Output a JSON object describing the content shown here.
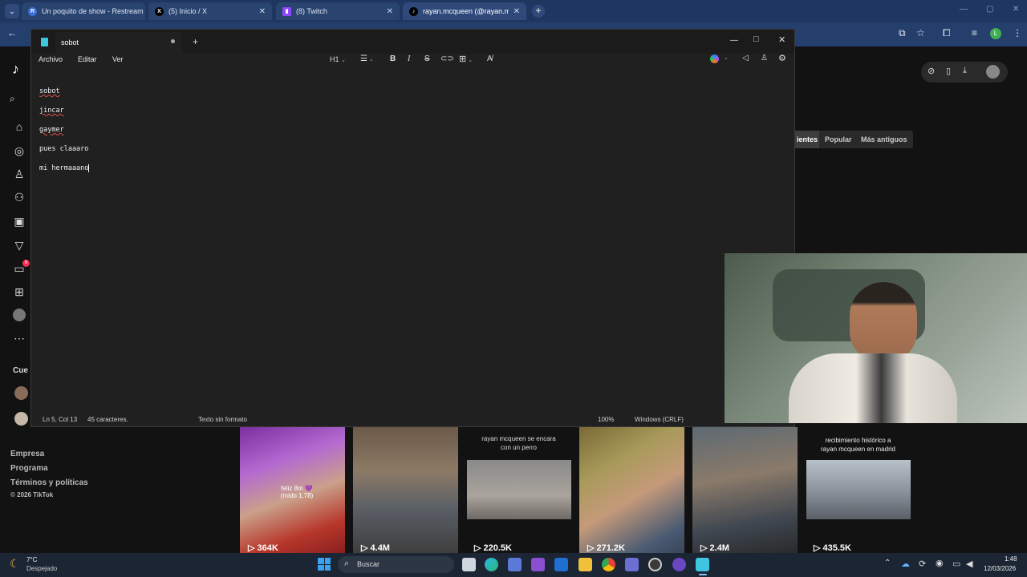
{
  "browser": {
    "tabs": [
      {
        "label": "Un poquito de show - Restream",
        "icon": "restream-icon"
      },
      {
        "label": "(5) Inicio / X",
        "icon": "x-icon"
      },
      {
        "label": "(8) Twitch",
        "icon": "twitch-icon"
      },
      {
        "label": "rayan.mcqueen (@rayan.mcque",
        "icon": "tiktok-icon"
      }
    ],
    "profile_letter": "L"
  },
  "notepad": {
    "tab_title": "sobot",
    "menu": [
      "Archivo",
      "Editar",
      "Ver"
    ],
    "heading_select": "H1",
    "lines": [
      "sobot",
      "jincar",
      "gaymer",
      "pues claaaro",
      "mi hermaaano"
    ],
    "status": {
      "position": "Ln 5, Col 13",
      "chars": "45 caracteres.",
      "format": "Texto sin formato",
      "zoom": "100%",
      "encoding": "Windows (CRLF)"
    }
  },
  "tiktok": {
    "sort_tabs": [
      "ientes",
      "Popular",
      "Más antiguos"
    ],
    "following_label": "Cue",
    "badge_count": "6",
    "footer": [
      "Empresa",
      "Programa",
      "Términos y políticas",
      "© 2026 TikTok"
    ],
    "videos": [
      {
        "views": "364K",
        "caption": "feliz 8m 💜\n(mido 1,78)"
      },
      {
        "views": "4.4M",
        "caption": ""
      },
      {
        "views": "220.5K",
        "caption": "rayan mcqueen se encara\ncon un perro"
      },
      {
        "views": "271.2K",
        "caption": ""
      },
      {
        "views": "2.4M",
        "caption": ""
      },
      {
        "views": "435.5K",
        "caption": "recibimiento histórico a\nrayan mcqueen en madrid"
      }
    ]
  },
  "taskbar": {
    "weather_temp": "7°C",
    "weather_desc": "Despejado",
    "search_placeholder": "Buscar",
    "time": "1:48",
    "date": "12/03/2026"
  }
}
